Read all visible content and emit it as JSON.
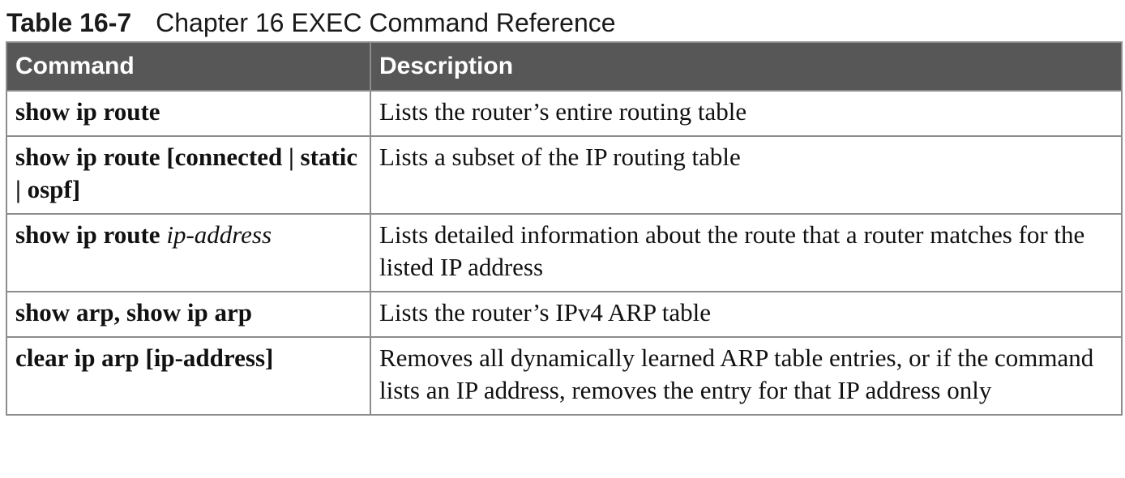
{
  "caption": {
    "label": "Table 16-7",
    "title": "Chapter 16 EXEC Command Reference"
  },
  "table": {
    "headers": [
      "Command",
      "Description"
    ],
    "rows": [
      {
        "command": "show ip route",
        "argument": "",
        "description": "Lists the router’s entire routing table"
      },
      {
        "command": "show ip route [connected | static | ospf]",
        "argument": "",
        "description": "Lists a subset of the IP routing table"
      },
      {
        "command": "show ip route",
        "argument": "ip-address",
        "description": "Lists detailed information about the route that a router matches for the listed IP address"
      },
      {
        "command": "show arp, show ip arp",
        "argument": "",
        "description": "Lists the router’s IPv4 ARP table"
      },
      {
        "command": "clear ip arp [ip-address]",
        "argument": "",
        "description": "Removes all dynamically learned ARP table entries, or if the command lists an IP address, removes the entry for that IP address only"
      }
    ]
  }
}
